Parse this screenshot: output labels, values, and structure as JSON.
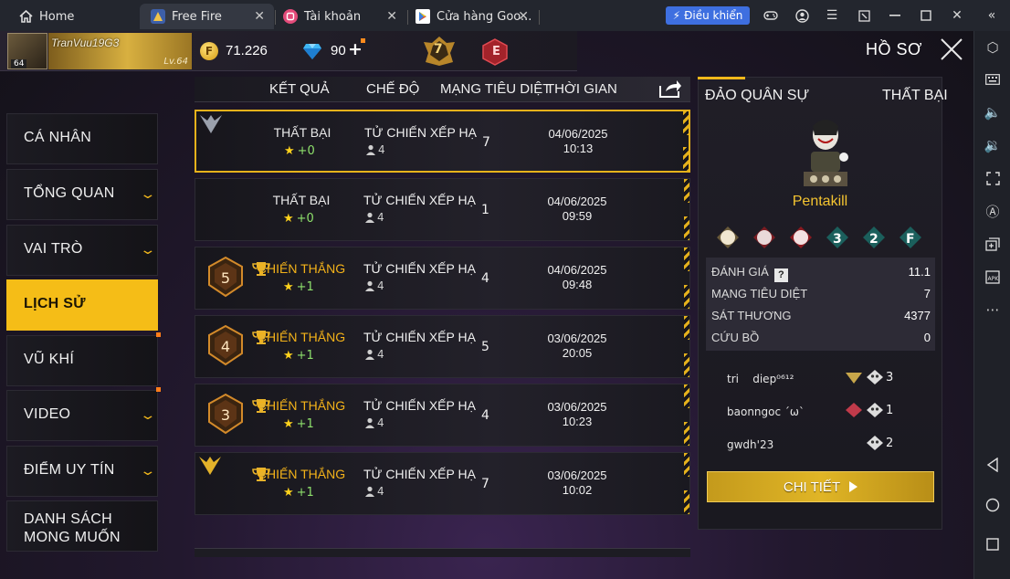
{
  "browser": {
    "tabs": [
      {
        "label": "Home"
      },
      {
        "label": "Free Fire"
      },
      {
        "label": "Tài khoản"
      },
      {
        "label": "Cửa hàng Goo..."
      }
    ],
    "control_button": "Điều khiển"
  },
  "header": {
    "player_name": "TranVuu19G3",
    "avatar_level": "64",
    "banner_level": "Lv.64",
    "gold": "71.226",
    "diamonds": "90",
    "rank_number": "7",
    "rank_badge": "E",
    "title": "HỒ SƠ"
  },
  "menu": [
    {
      "label": "CÁ NHÂN",
      "chevron": false,
      "dot": false
    },
    {
      "label": "TỔNG QUAN",
      "chevron": true,
      "dot": false
    },
    {
      "label": "VAI TRÒ",
      "chevron": true,
      "dot": false
    },
    {
      "label": "LỊCH SỬ",
      "chevron": false,
      "dot": false,
      "active": true
    },
    {
      "label": "VŨ KHÍ",
      "chevron": false,
      "dot": true
    },
    {
      "label": "VIDEO",
      "chevron": true,
      "dot": true
    },
    {
      "label": "ĐIỂM UY TÍN",
      "chevron": true,
      "dot": false
    },
    {
      "label": "DANH SÁCH MONG MUỐN",
      "chevron": false,
      "dot": false
    }
  ],
  "table": {
    "headers": {
      "result": "KẾT QUẢ",
      "mode": "CHẾ ĐỘ",
      "kills": "MẠNG TIÊU DIỆT",
      "time": "THỜI GIAN"
    },
    "rows": [
      {
        "medal": "",
        "result": "THẤT BẠI",
        "win": false,
        "points": "+0",
        "mode": "TỬ CHIẾN XẾP HẠ",
        "squad": "4",
        "kills": "7",
        "date": "04/06/2025",
        "time": "10:13"
      },
      {
        "medal": "",
        "result": "THẤT BẠI",
        "win": false,
        "points": "+0",
        "mode": "TỬ CHIẾN XẾP HẠ",
        "squad": "4",
        "kills": "1",
        "date": "04/06/2025",
        "time": "09:59"
      },
      {
        "medal": "5",
        "result": "CHIẾN THẮNG",
        "win": true,
        "points": "+1",
        "mode": "TỬ CHIẾN XẾP HẠ",
        "squad": "4",
        "kills": "4",
        "date": "04/06/2025",
        "time": "09:48"
      },
      {
        "medal": "4",
        "result": "CHIẾN THẮNG",
        "win": true,
        "points": "+1",
        "mode": "TỬ CHIẾN XẾP HẠ",
        "squad": "4",
        "kills": "5",
        "date": "03/06/2025",
        "time": "20:05"
      },
      {
        "medal": "3",
        "result": "CHIẾN THẮNG",
        "win": true,
        "points": "+1",
        "mode": "TỬ CHIẾN XẾP HẠ",
        "squad": "4",
        "kills": "4",
        "date": "03/06/2025",
        "time": "10:23"
      },
      {
        "medal": "",
        "result": "CHIẾN THẮNG",
        "win": true,
        "points": "+1",
        "mode": "TỬ CHIẾN XẾP HẠ",
        "squad": "4",
        "kills": "7",
        "date": "03/06/2025",
        "time": "10:02"
      }
    ]
  },
  "detail": {
    "map": "ĐẢO QUÂN SỰ",
    "result": "THẤT BẠI",
    "character": "Pentakill",
    "badge_labels": [
      "3",
      "2",
      "F"
    ],
    "stats": [
      {
        "label": "ĐÁNH GIÁ",
        "value": "11.1",
        "help": "?"
      },
      {
        "label": "MẠNG TIÊU DIỆT",
        "value": "7"
      },
      {
        "label": "SÁT THƯƠNG",
        "value": "4377"
      },
      {
        "label": "CỨU BỒ",
        "value": "0"
      }
    ],
    "teammates": [
      {
        "name": "tri    diep⁰⁶¹²",
        "kills": "3",
        "badge": "7"
      },
      {
        "name": "baonngoc ´ω`",
        "kills": "1",
        "badge": ""
      },
      {
        "name": "gwdh'23",
        "kills": "2",
        "badge": ""
      }
    ],
    "button": "CHI TIẾT"
  }
}
